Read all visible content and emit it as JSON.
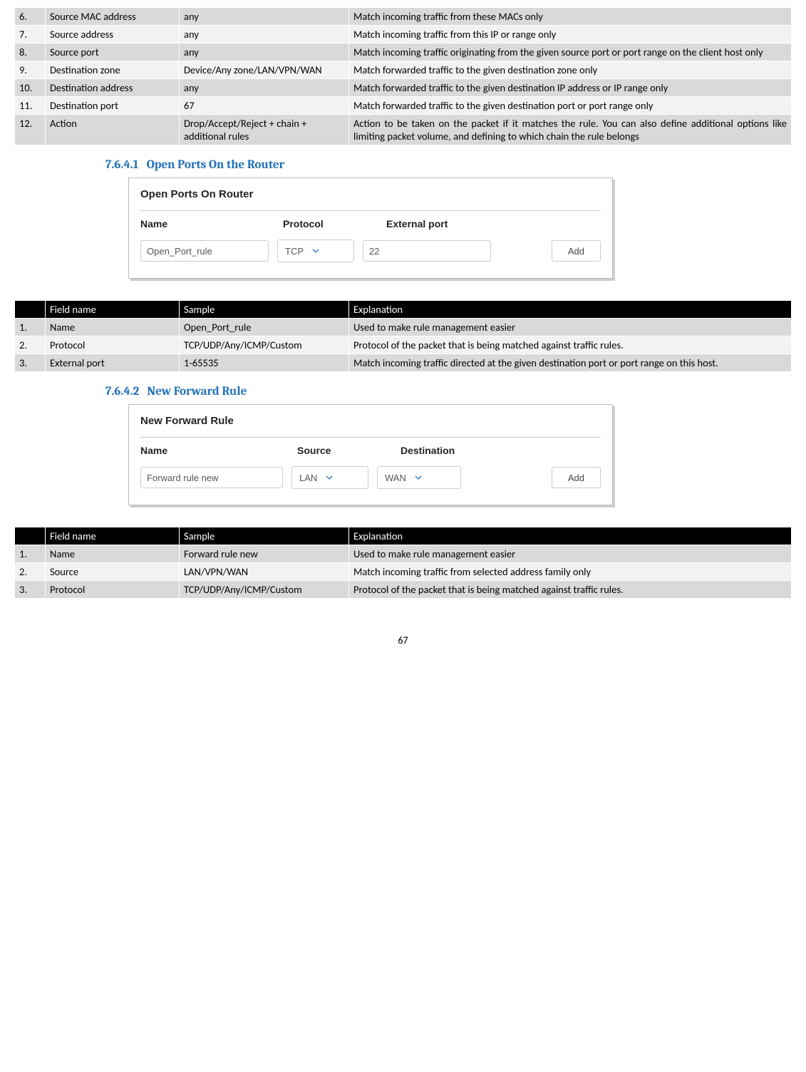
{
  "table1": {
    "rows": [
      {
        "n": "6.",
        "field": "Source MAC address",
        "possible": "any",
        "desc": "Match incoming traffic from these MACs only"
      },
      {
        "n": "7.",
        "field": "Source address",
        "possible": "any",
        "desc": "Match incoming traffic from this IP or range only"
      },
      {
        "n": "8.",
        "field": "Source port",
        "possible": "any",
        "desc": "Match incoming traffic originating from the given source port or port range on the client host only"
      },
      {
        "n": "9.",
        "field": "Destination zone",
        "possible": "Device/Any zone/LAN/VPN/WAN",
        "desc": "Match forwarded traffic to the given destination zone only"
      },
      {
        "n": "10.",
        "field": "Destination address",
        "possible": "any",
        "desc": "Match forwarded traffic to the given destination IP address or IP range only"
      },
      {
        "n": "11.",
        "field": "Destination port",
        "possible": "67",
        "desc": "Match forwarded traffic to the given destination port or port range only"
      },
      {
        "n": "12.",
        "field": "Action",
        "possible": "Drop/Accept/Reject + chain + additional rules",
        "desc": "Action to be taken on the packet if it matches the rule. You can also define additional options like limiting packet volume, and defining to which chain the rule belongs"
      }
    ]
  },
  "section1": {
    "number": "7.6.4.1",
    "title": "Open Ports On the Router",
    "panel": {
      "title": "Open Ports On Router",
      "label_name": "Name",
      "label_protocol": "Protocol",
      "label_ext": "External port",
      "input_name": "Open_Port_rule",
      "select_protocol": "TCP",
      "input_port": "22",
      "add_btn": "Add"
    },
    "table": {
      "header": {
        "n": "",
        "field": "Field name",
        "possible": "Sample",
        "desc": "Explanation"
      },
      "rows": [
        {
          "n": "1.",
          "field": "Name",
          "possible": "Open_Port_rule",
          "desc": "Used to make rule management easier"
        },
        {
          "n": "2.",
          "field": "Protocol",
          "possible": "TCP/UDP/Any/ICMP/Custom",
          "desc": "Protocol of the packet that is being matched against traffic rules."
        },
        {
          "n": "3.",
          "field": "External port",
          "possible": "1-65535",
          "desc": "Match incoming traffic directed at the given destination port or port range on this host."
        }
      ]
    }
  },
  "section2": {
    "number": "7.6.4.2",
    "title": "New Forward Rule",
    "panel": {
      "title": "New Forward Rule",
      "label_name": "Name",
      "label_source": "Source",
      "label_dest": "Destination",
      "input_name": "Forward rule new",
      "select_source": "LAN",
      "select_dest": "WAN",
      "add_btn": "Add"
    },
    "table": {
      "header": {
        "n": "",
        "field": "Field name",
        "possible": "Sample",
        "desc": "Explanation"
      },
      "rows": [
        {
          "n": "1.",
          "field": "Name",
          "possible": "Forward rule new",
          "desc": "Used to make rule management easier"
        },
        {
          "n": "2.",
          "field": "Source",
          "possible": "LAN/VPN/WAN",
          "desc": "Match incoming traffic from selected address family only"
        },
        {
          "n": "3.",
          "field": "Protocol",
          "possible": "TCP/UDP/Any/ICMP/Custom",
          "desc": "Protocol of the packet that is being matched against traffic rules."
        }
      ]
    }
  },
  "page_number": "67"
}
